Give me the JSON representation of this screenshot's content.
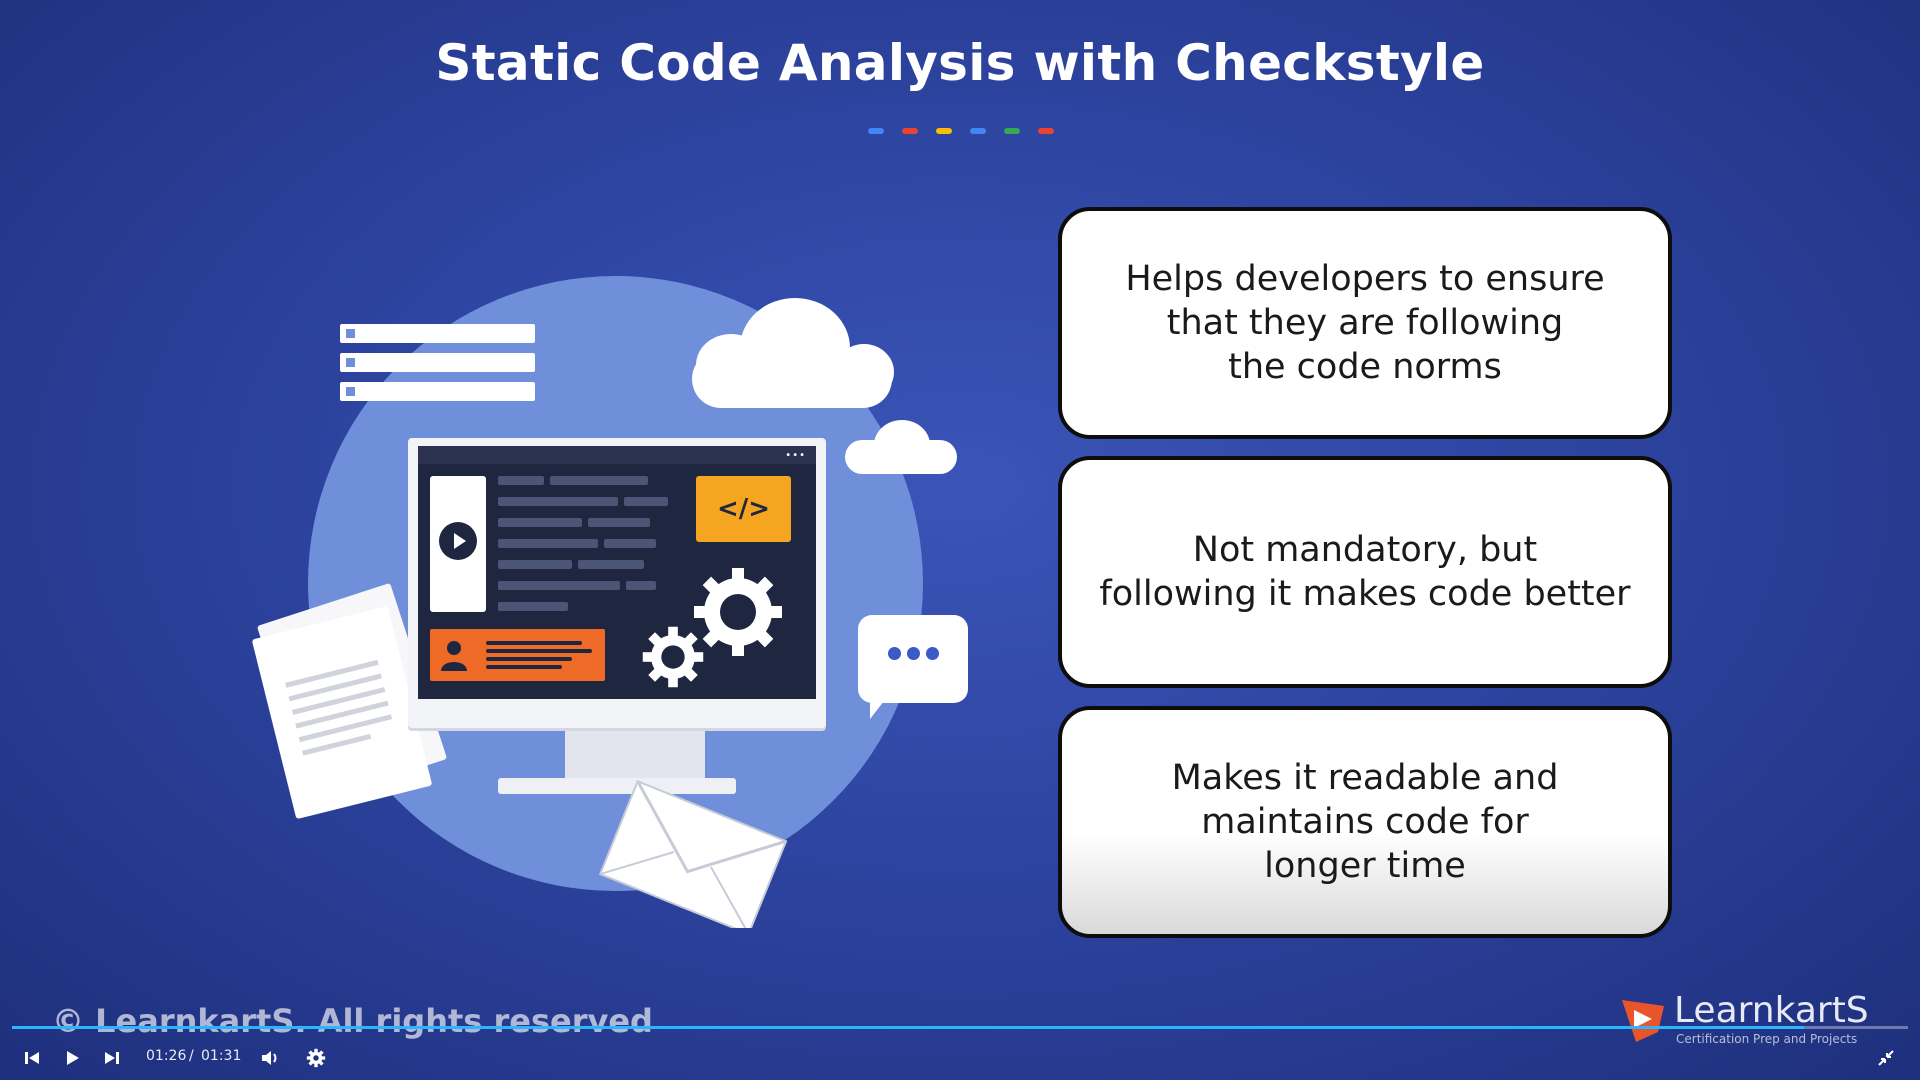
{
  "slide": {
    "title": "Static Code Analysis with Checkstyle",
    "dot_colors": [
      "#4285f4",
      "#ea4335",
      "#fbbc05",
      "#4285f4",
      "#34a853",
      "#ea4335"
    ],
    "illustration": {
      "code_badge": "</>",
      "menu_dots": "•••"
    },
    "cards": [
      "Helps developers to ensure\nthat they are following\nthe code norms",
      "Not mandatory, but\nfollowing it makes code better",
      "Makes it readable and\nmaintains code for\nlonger time"
    ],
    "copyright": "© LearnkartS. All rights reserved",
    "brand": {
      "name": "LearnkartS",
      "tagline": "Certification Prep and Projects"
    }
  },
  "player": {
    "current_time": "01:26",
    "separator": "/",
    "duration": "01:31",
    "progress_fraction": 0.945,
    "accent_color": "#2bb5ff",
    "icons": [
      "skip-back-icon",
      "play-icon",
      "skip-forward-icon",
      "volume-icon",
      "settings-icon",
      "exit-fullscreen-icon"
    ]
  }
}
